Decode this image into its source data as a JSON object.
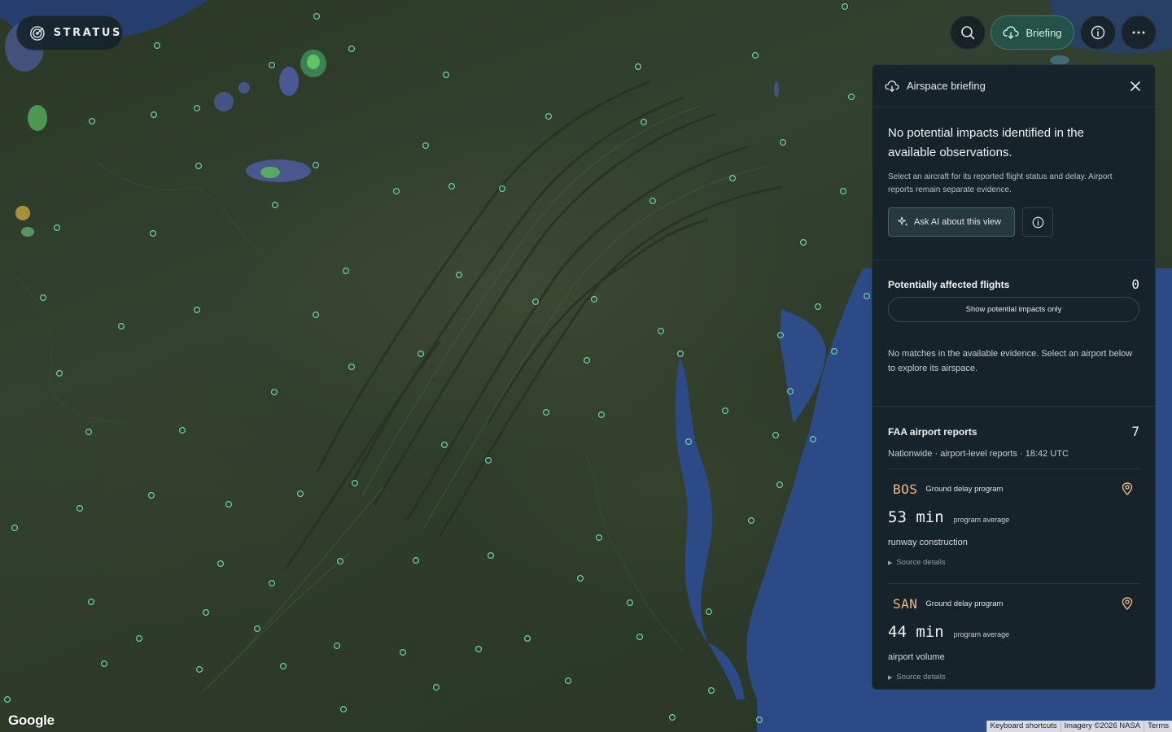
{
  "app": {
    "brand": "STRATUS"
  },
  "toolbar": {
    "search_icon": "search-icon",
    "briefing_label": "Briefing",
    "briefing_icon": "cloud-icon",
    "info_icon": "info-icon",
    "more_icon": "ellipsis-icon"
  },
  "panel": {
    "title": "Airspace briefing",
    "summary_title": "No potential impacts identified in the available observations.",
    "summary_body": "Select an aircraft for its reported flight status and delay. Airport reports remain separate evidence.",
    "ask_label": "Ask AI about this view",
    "flights": {
      "heading": "Potentially affected flights",
      "count": "0",
      "filter_label": "Show potential impacts only",
      "empty_note": "No matches in the available evidence. Select an airport below to explore its airspace."
    },
    "faa": {
      "heading": "FAA airport reports",
      "count": "7",
      "subtitle": "Nationwide · airport-level reports · 18:42 UTC",
      "reports": [
        {
          "code": "BOS",
          "type": "Ground delay program",
          "delay": "53 min",
          "delay_note": "program average",
          "reason": "runway construction",
          "source": "Source details"
        },
        {
          "code": "SAN",
          "type": "Ground delay program",
          "delay": "44 min",
          "delay_note": "program average",
          "reason": "airport volume",
          "source": "Source details"
        }
      ]
    }
  },
  "map": {
    "logo": "Google",
    "attribution": [
      "Keyboard shortcuts",
      "Imagery ©2026 NASA",
      "Terms"
    ]
  },
  "colors": {
    "accent": "#7fd1bf",
    "airport_code": "#f1b98d",
    "panel_bg": "#17232a",
    "station_marker": "#6fcfb2"
  }
}
